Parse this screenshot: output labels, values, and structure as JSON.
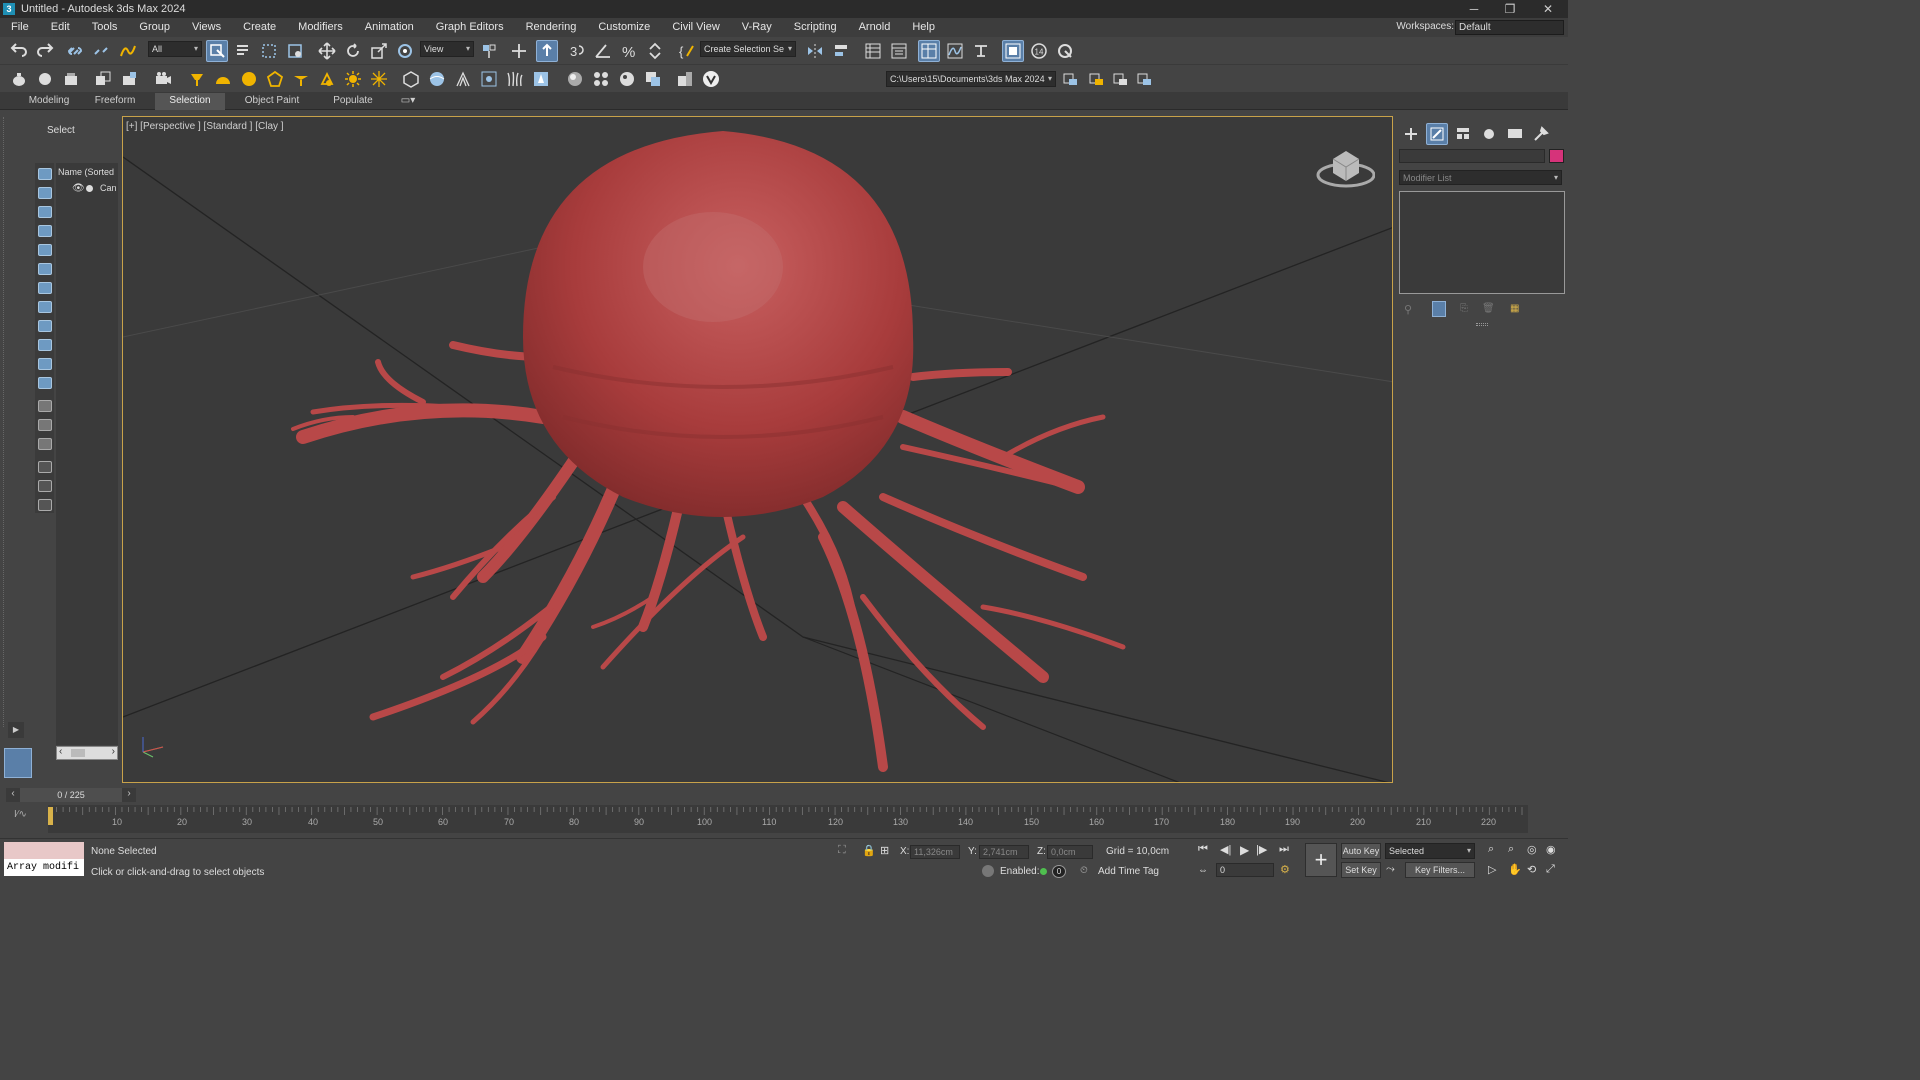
{
  "window": {
    "title": "Untitled - Autodesk 3ds Max 2024",
    "app_icon_letter": "3",
    "controls": [
      "─",
      "❐",
      "✕"
    ]
  },
  "menubar": {
    "items": [
      "File",
      "Edit",
      "Tools",
      "Group",
      "Views",
      "Create",
      "Modifiers",
      "Animation",
      "Graph Editors",
      "Rendering",
      "Customize",
      "Civil View",
      "V-Ray",
      "Scripting",
      "Arnold",
      "Help"
    ],
    "workspace_label": "Workspaces:",
    "workspace_value": "Default"
  },
  "main_toolbar": {
    "selection_filter": "All",
    "ref_coord": "View",
    "named_selection": "Create Selection Se",
    "snap_count": "14"
  },
  "secondary_toolbar": {
    "project_path": "C:\\Users\\15\\Documents\\3ds Max 2024"
  },
  "ribbon": {
    "tabs": [
      "Modeling",
      "Freeform",
      "Selection",
      "Object Paint",
      "Populate"
    ],
    "active_tab": "Selection"
  },
  "scene_explorer": {
    "title": "Select",
    "column_header": "Name (Sorted A",
    "items": [
      "Can"
    ]
  },
  "viewport": {
    "label": "[+] [Perspective ] [Standard ] [Clay ]",
    "object_color": "#b84848"
  },
  "command_panel": {
    "modifier_list": "Modifier List",
    "color_swatch": "#d6337a"
  },
  "timeline": {
    "frame_display": "0 / 225",
    "ticks": [
      "10",
      "20",
      "30",
      "40",
      "50",
      "60",
      "70",
      "80",
      "90",
      "100",
      "110",
      "120",
      "130",
      "140",
      "150",
      "160",
      "170",
      "180",
      "190",
      "200",
      "210",
      "220"
    ]
  },
  "status": {
    "maxscript_text": "Array modifi",
    "selection_status": "None Selected",
    "prompt": "Click or click-and-drag to select objects",
    "x_label": "X:",
    "x_value": "11,326cm",
    "y_label": "Y:",
    "y_value": "2,741cm",
    "z_label": "Z:",
    "z_value": "0,0cm",
    "grid": "Grid = 10,0cm",
    "enabled_label": "Enabled:",
    "enabled_count": "0",
    "add_time_tag": "Add Time Tag",
    "auto_key": "Auto Key",
    "set_key": "Set Key",
    "key_mode": "Selected",
    "key_filters": "Key Filters...",
    "current_frame": "0"
  }
}
